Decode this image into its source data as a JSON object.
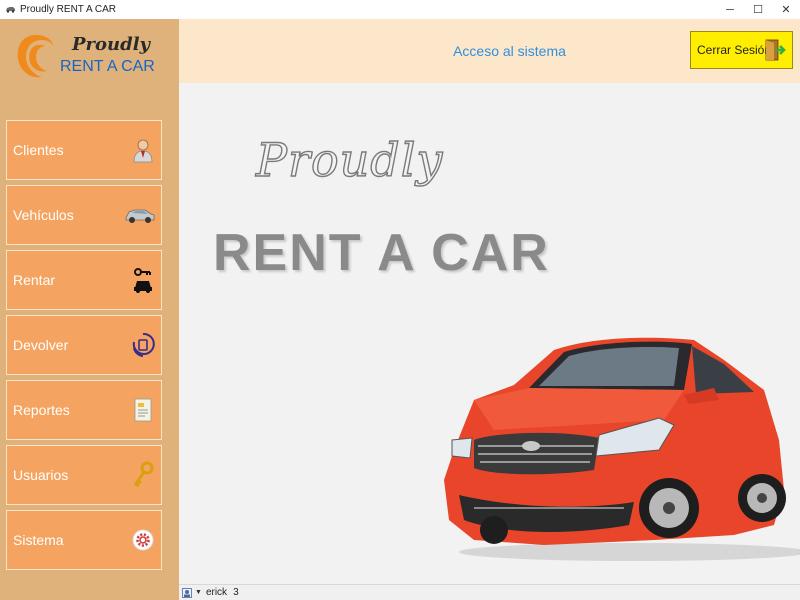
{
  "window": {
    "title": "Proudly RENT A CAR",
    "controls": {
      "minimize": "─",
      "maximize": "☐",
      "close": "✕"
    }
  },
  "logo": {
    "line1": "Proudly",
    "line2": "RENT A CAR",
    "accent": "#f08a1c",
    "text_color": "#1565c8"
  },
  "sidebar": {
    "background": "#e0b27b",
    "item_color": "#f4a460",
    "items": [
      {
        "label": "Clientes",
        "icon": "user-icon"
      },
      {
        "label": "Vehículos",
        "icon": "car-icon"
      },
      {
        "label": "Rentar",
        "icon": "car-key-icon"
      },
      {
        "label": "Devolver",
        "icon": "return-icon"
      },
      {
        "label": "Reportes",
        "icon": "report-icon"
      },
      {
        "label": "Usuarios",
        "icon": "key-icon"
      },
      {
        "label": "Sistema",
        "icon": "gear-icon"
      }
    ]
  },
  "header": {
    "title": "Acceso al sistema",
    "logout_label": "Cerrar Sesión",
    "logout_icon": "exit-door-icon",
    "logout_color": "#ffee00"
  },
  "main": {
    "brand_line1": "Proudly",
    "brand_line2": "RENT A CAR",
    "car_color": "#e8452a"
  },
  "statusbar": {
    "user": "erick",
    "count": "3"
  }
}
